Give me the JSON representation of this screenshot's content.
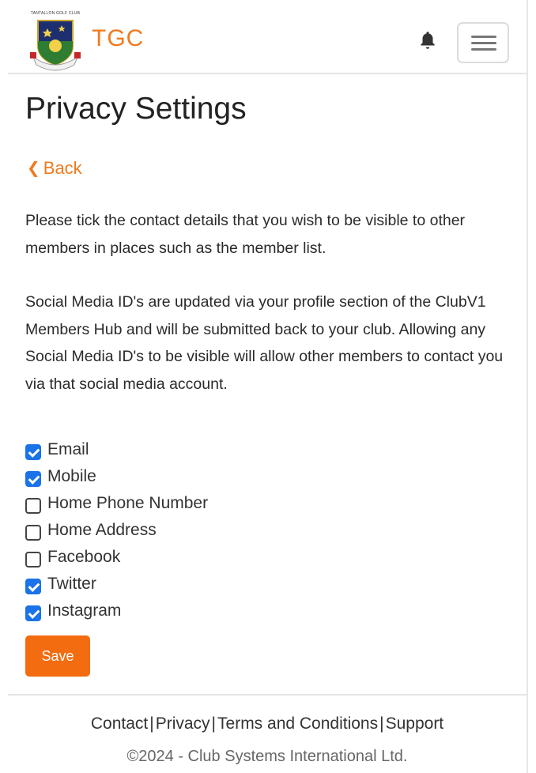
{
  "header": {
    "logo_caption": "TANTALLON GOLF CLUB",
    "brand": "TGC"
  },
  "page": {
    "title": "Privacy Settings",
    "back_label": "Back",
    "paragraph_1": "Please tick the contact details that you wish to be visible to other members in places such as the member list.",
    "paragraph_2": "Social Media ID's are updated via your profile section of the ClubV1 Members Hub and will be submitted back to your club. Allowing any Social Media ID's to be visible will allow other members to contact you via that social media account."
  },
  "options": [
    {
      "label": "Email",
      "checked": true
    },
    {
      "label": "Mobile",
      "checked": true
    },
    {
      "label": "Home Phone Number",
      "checked": false
    },
    {
      "label": "Home Address",
      "checked": false
    },
    {
      "label": "Facebook",
      "checked": false
    },
    {
      "label": "Twitter",
      "checked": true
    },
    {
      "label": "Instagram",
      "checked": true
    }
  ],
  "save_label": "Save",
  "footer": {
    "links": [
      "Contact",
      "Privacy",
      "Terms and Conditions",
      "Support"
    ],
    "separator": "|",
    "copyright": "©2024 - Club Systems International Ltd."
  },
  "colors": {
    "accent": "#f07a1e",
    "save_button": "#f36c0f",
    "checkbox_checked": "#1a73e8"
  },
  "icons": {
    "bell": "bell-icon",
    "menu": "hamburger-menu-icon",
    "back": "chevron-left-icon"
  }
}
